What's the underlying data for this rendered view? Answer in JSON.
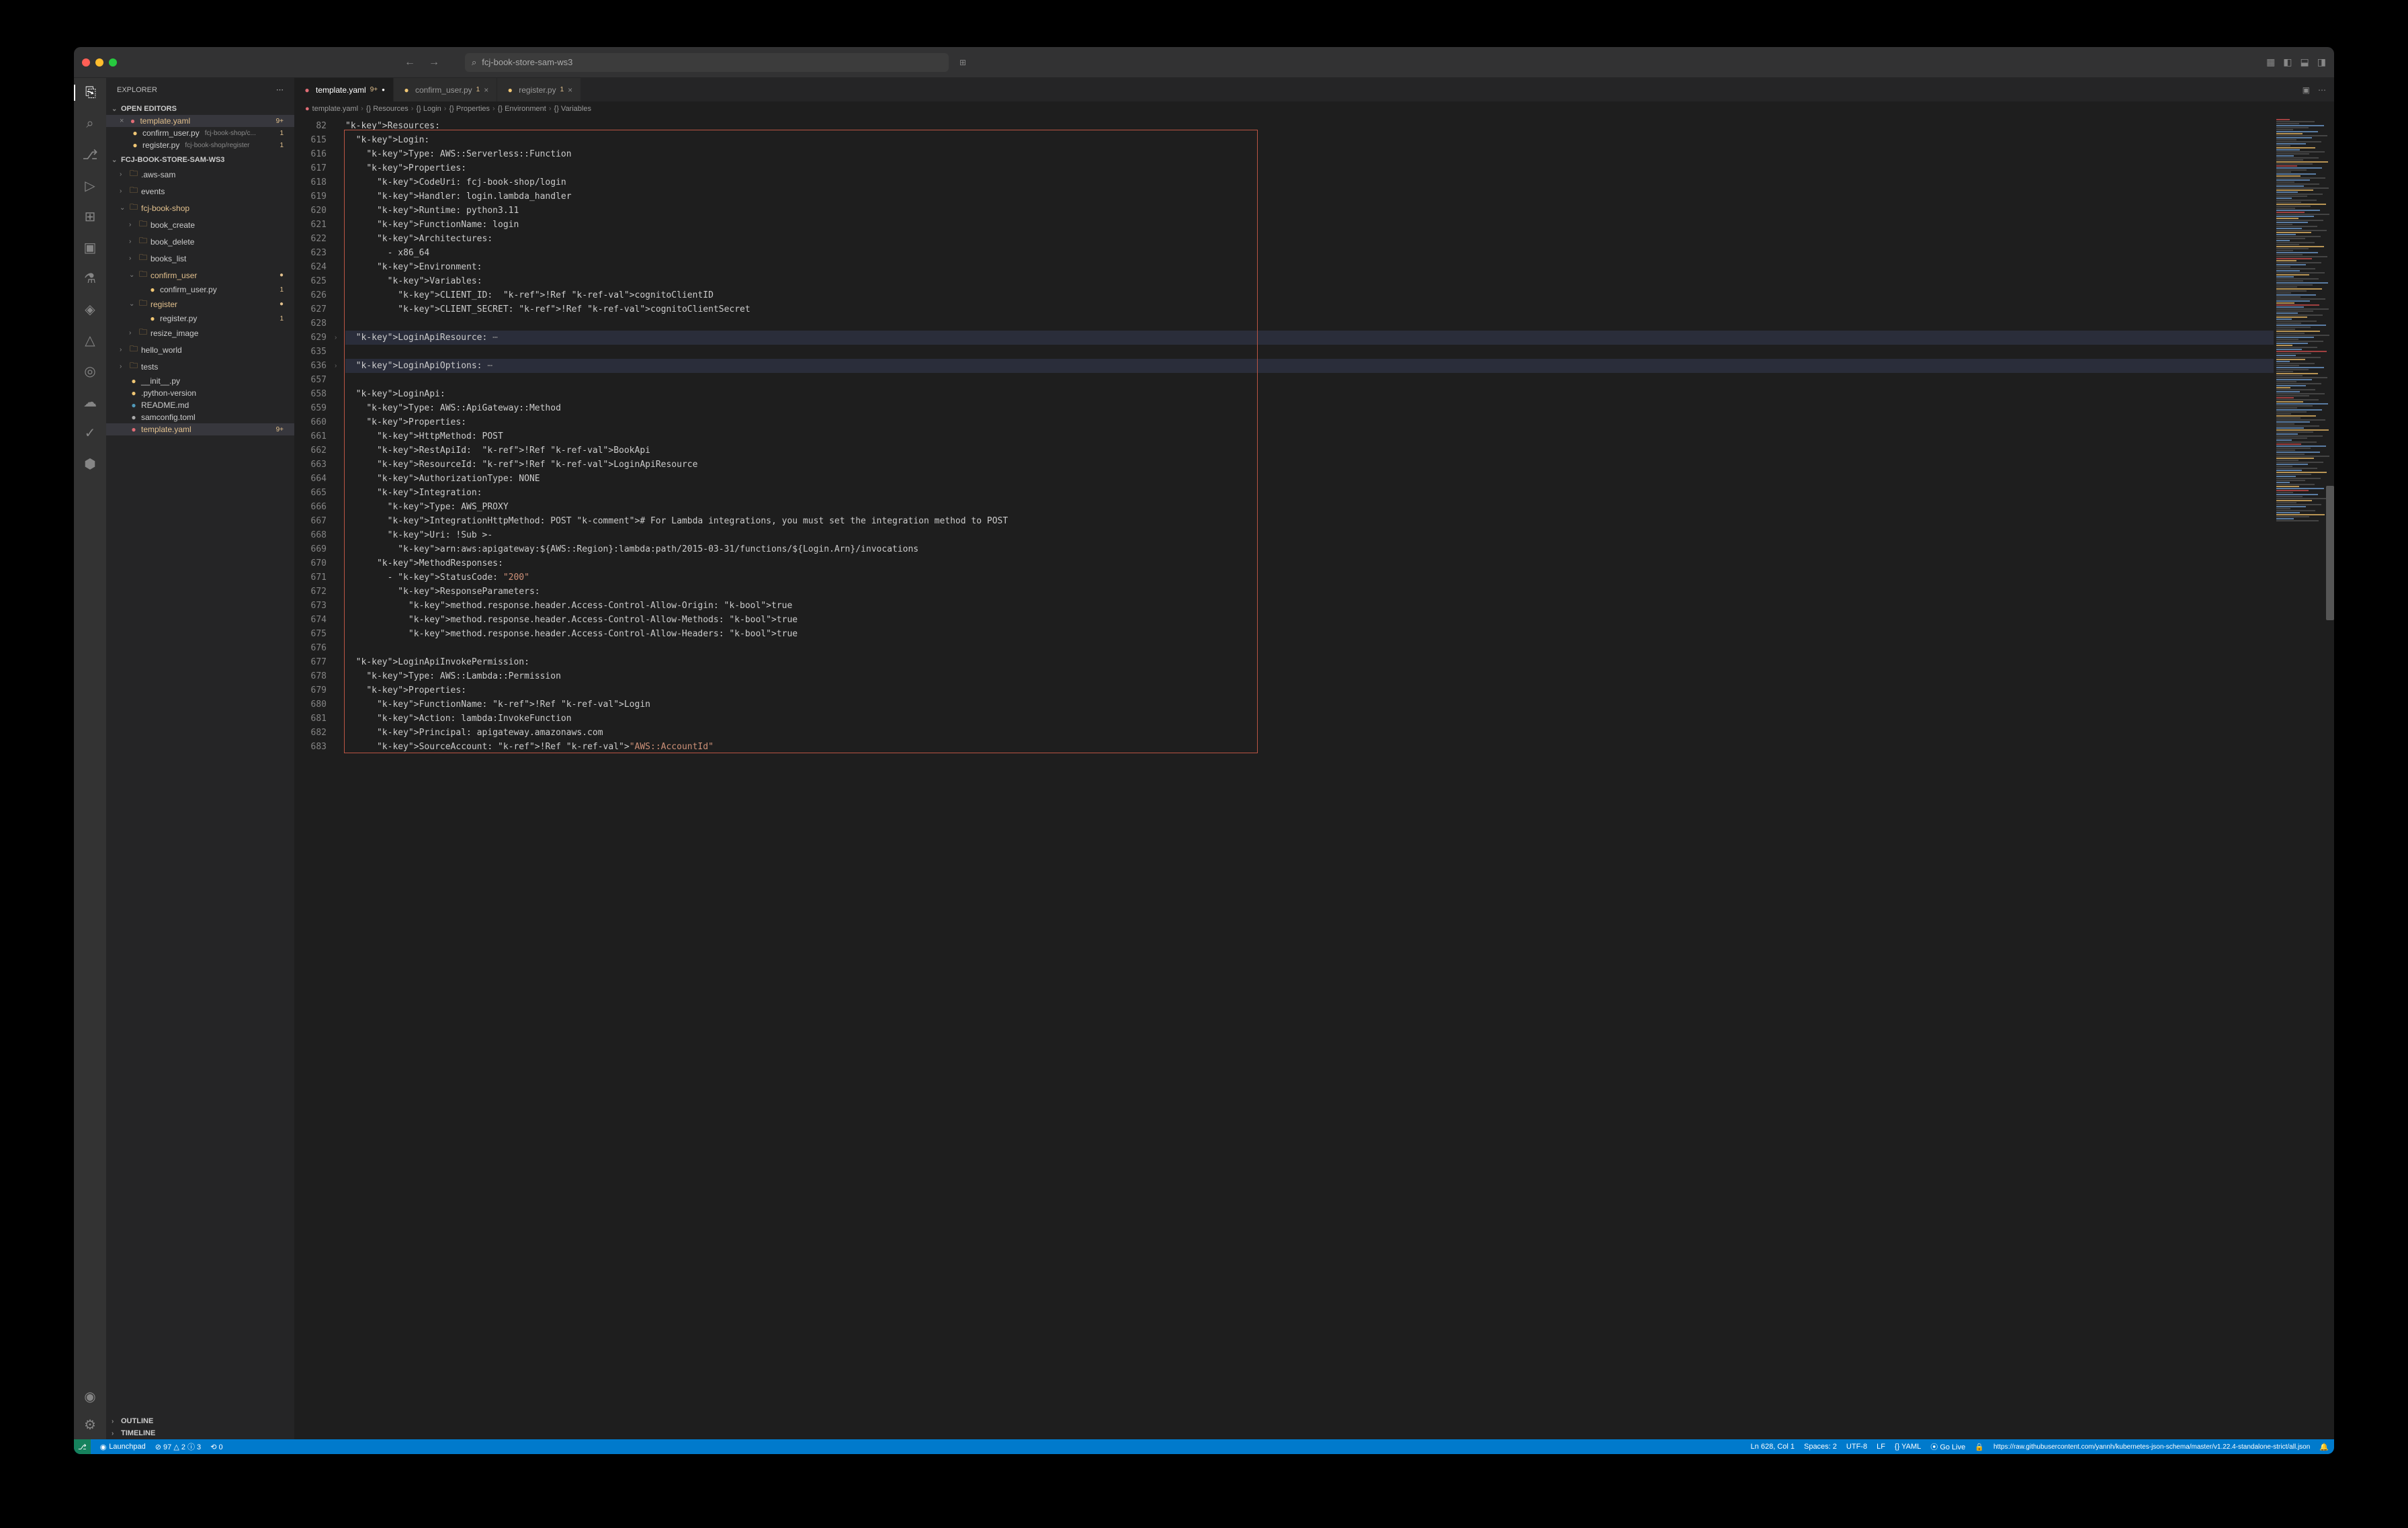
{
  "titlebar": {
    "search_text": "fcj-book-store-sam-ws3"
  },
  "explorer": {
    "title": "EXPLORER",
    "open_editors_label": "OPEN EDITORS",
    "open_editors": [
      {
        "name": "template.yaml",
        "badge": "9+",
        "icon": "yaml",
        "modified": true,
        "active": true
      },
      {
        "name": "confirm_user.py",
        "path": "fcj-book-shop/c...",
        "badge": "1",
        "icon": "py"
      },
      {
        "name": "register.py",
        "path": "fcj-book-shop/register",
        "badge": "1",
        "icon": "py"
      }
    ],
    "project_label": "FCJ-BOOK-STORE-SAM-WS3",
    "tree": [
      {
        "type": "folder",
        "name": ".aws-sam",
        "indent": 1,
        "open": false
      },
      {
        "type": "folder",
        "name": "events",
        "indent": 1,
        "open": false
      },
      {
        "type": "folder",
        "name": "fcj-book-shop",
        "indent": 1,
        "open": true,
        "modified": true
      },
      {
        "type": "folder",
        "name": "book_create",
        "indent": 2,
        "open": false
      },
      {
        "type": "folder",
        "name": "book_delete",
        "indent": 2,
        "open": false
      },
      {
        "type": "folder",
        "name": "books_list",
        "indent": 2,
        "open": false
      },
      {
        "type": "folder",
        "name": "confirm_user",
        "indent": 2,
        "open": true,
        "modified": true,
        "badge": "●"
      },
      {
        "type": "file",
        "name": "confirm_user.py",
        "indent": 3,
        "icon": "py",
        "badge": "1"
      },
      {
        "type": "folder",
        "name": "register",
        "indent": 2,
        "open": true,
        "modified": true,
        "badge": "●"
      },
      {
        "type": "file",
        "name": "register.py",
        "indent": 3,
        "icon": "py",
        "badge": "1"
      },
      {
        "type": "folder",
        "name": "resize_image",
        "indent": 2,
        "open": false
      },
      {
        "type": "folder",
        "name": "hello_world",
        "indent": 1,
        "open": false
      },
      {
        "type": "folder",
        "name": "tests",
        "indent": 1,
        "open": false
      },
      {
        "type": "file",
        "name": "__init__.py",
        "indent": 1,
        "icon": "py"
      },
      {
        "type": "file",
        "name": ".python-version",
        "indent": 1,
        "icon": "py"
      },
      {
        "type": "file",
        "name": "README.md",
        "indent": 1,
        "icon": "md"
      },
      {
        "type": "file",
        "name": "samconfig.toml",
        "indent": 1,
        "icon": "toml"
      },
      {
        "type": "file",
        "name": "template.yaml",
        "indent": 1,
        "icon": "yaml",
        "modified": true,
        "active": true,
        "badge": "9+"
      }
    ],
    "outline_label": "OUTLINE",
    "timeline_label": "TIMELINE"
  },
  "tabs": [
    {
      "name": "template.yaml",
      "icon": "yaml",
      "badge": "9+",
      "active": true,
      "dirty": true
    },
    {
      "name": "confirm_user.py",
      "icon": "py",
      "badge": "1",
      "active": false
    },
    {
      "name": "register.py",
      "icon": "py",
      "badge": "1",
      "active": false
    }
  ],
  "breadcrumb": [
    "template.yaml",
    "{} Resources",
    "{} Login",
    "{} Properties",
    "{} Environment",
    "{} Variables"
  ],
  "line_numbers": [
    82,
    615,
    616,
    617,
    618,
    619,
    620,
    621,
    622,
    623,
    624,
    625,
    626,
    627,
    628,
    629,
    635,
    636,
    657,
    658,
    659,
    660,
    661,
    662,
    663,
    664,
    665,
    666,
    667,
    668,
    669,
    670,
    671,
    672,
    673,
    674,
    675,
    676,
    677,
    678,
    679,
    680,
    681,
    682,
    683
  ],
  "fold_marks": {
    "15": "›",
    "17": "›"
  },
  "code": {
    "l0": "Resources:",
    "l1": "  Login:",
    "l2": "    Type: AWS::Serverless::Function",
    "l3": "    Properties:",
    "l4": "      CodeUri: fcj-book-shop/login",
    "l5": "      Handler: login.lambda_handler",
    "l6": "      Runtime: python3.11",
    "l7": "      FunctionName: login",
    "l8": "      Architectures:",
    "l9": "        - x86_64",
    "l10": "      Environment:",
    "l11": "        Variables:",
    "l12": "          CLIENT_ID:  !Ref cognitoClientID",
    "l13": "          CLIENT_SECRET: !Ref cognitoClientSecret",
    "l14": "",
    "l15": "  LoginApiResource: ⋯",
    "l16": "",
    "l17": "  LoginApiOptions: ⋯",
    "l18": "",
    "l19": "  LoginApi:",
    "l20": "    Type: AWS::ApiGateway::Method",
    "l21": "    Properties:",
    "l22": "      HttpMethod: POST",
    "l23": "      RestApiId:  !Ref BookApi",
    "l24": "      ResourceId: !Ref LoginApiResource",
    "l25": "      AuthorizationType: NONE",
    "l26": "      Integration:",
    "l27": "        Type: AWS_PROXY",
    "l28": "        IntegrationHttpMethod: POST # For Lambda integrations, you must set the integration method to POST",
    "l29": "        Uri: !Sub >-",
    "l30": "          arn:aws:apigateway:${AWS::Region}:lambda:path/2015-03-31/functions/${Login.Arn}/invocations",
    "l31": "      MethodResponses:",
    "l32": "        - StatusCode: \"200\"",
    "l33": "          ResponseParameters:",
    "l34": "            method.response.header.Access-Control-Allow-Origin: true",
    "l35": "            method.response.header.Access-Control-Allow-Methods: true",
    "l36": "            method.response.header.Access-Control-Allow-Headers: true",
    "l37": "",
    "l38": "  LoginApiInvokePermission:",
    "l39": "    Type: AWS::Lambda::Permission",
    "l40": "    Properties:",
    "l41": "      FunctionName: !Ref Login",
    "l42": "      Action: lambda:InvokeFunction",
    "l43": "      Principal: apigateway.amazonaws.com",
    "l44": "      SourceAccount: !Ref \"AWS::AccountId\""
  },
  "statusbar": {
    "remote": "⎇",
    "launchpad": "Launchpad",
    "problems": "⊘ 97 △ 2 ⓘ 3",
    "ports": "⟲ 0",
    "line_col": "Ln 628, Col 1",
    "spaces": "Spaces: 2",
    "encoding": "UTF-8",
    "eol": "LF",
    "lang": "{} YAML",
    "golive": "⦿ Go Live",
    "lock": "🔒",
    "schema": "https://raw.githubusercontent.com/yannh/kubernetes-json-schema/master/v1.22.4-standalone-strict/all.json",
    "bell": "🔔"
  }
}
